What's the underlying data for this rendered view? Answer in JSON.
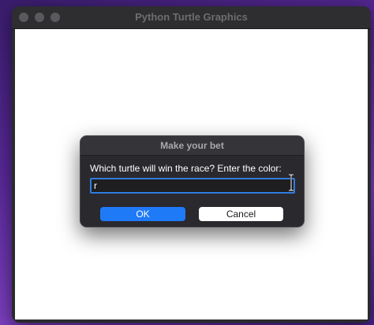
{
  "window": {
    "title": "Python Turtle Graphics"
  },
  "dialog": {
    "title": "Make your bet",
    "prompt": "Which turtle will win the race? Enter the color:",
    "input_value": "r",
    "ok_label": "OK",
    "cancel_label": "Cancel"
  },
  "colors": {
    "accent": "#1f7af8",
    "focus_ring": "#2f7de1",
    "dialog_bg": "#2a292d",
    "canvas_bg": "#ffffff"
  }
}
